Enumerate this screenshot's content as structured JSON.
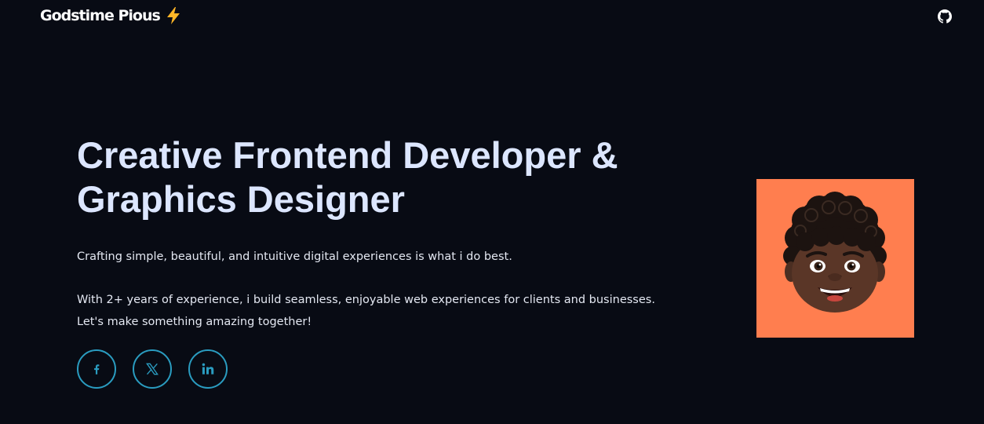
{
  "nav": {
    "brand_name": "Godstime Pious",
    "brand_icon": "lightning-bolt-icon",
    "github_icon": "github-icon"
  },
  "hero": {
    "headline_line1": "Creative Frontend Developer &",
    "headline_line2": "Graphics Designer",
    "lead": "Crafting simple, beautiful, and intuitive digital experiences is what i do best.",
    "detail_line1": "With 2+ years of experience, i build seamless, enjoyable web experiences for clients and businesses.",
    "detail_line2": "Let's make something amazing together!"
  },
  "socials": [
    {
      "icon": "facebook-icon"
    },
    {
      "icon": "x-icon"
    },
    {
      "icon": "linkedin-icon"
    }
  ],
  "avatar": {
    "icon": "memoji-avatar",
    "background": "#ff7e4f"
  },
  "colors": {
    "background": "#080b14",
    "headline": "#dce6ff",
    "body_text": "#e4e8f2",
    "accent": "#2a9cc0",
    "bolt": "#ffb627"
  }
}
